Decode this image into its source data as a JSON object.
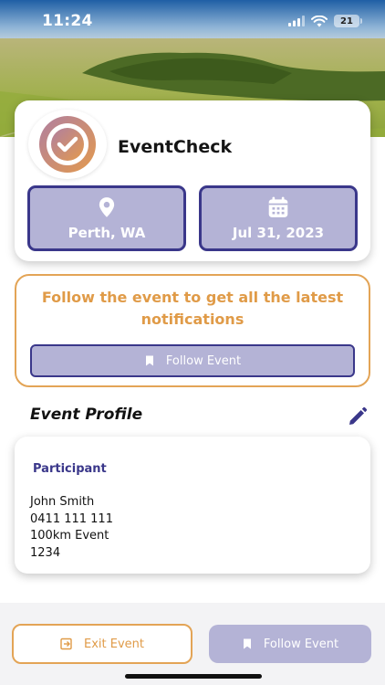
{
  "status_bar": {
    "time": "11:24",
    "battery": "21"
  },
  "event": {
    "app_name": "EventCheck",
    "location": "Perth, WA",
    "date": "Jul 31, 2023",
    "location_icon": "map-pin-icon",
    "date_icon": "calendar-icon"
  },
  "follow_prompt": {
    "message": "Follow the event to get all the latest notifications",
    "button_label": "Follow Event"
  },
  "profile": {
    "section_title": "Event Profile",
    "heading": "Participant",
    "name": "John Smith",
    "phone": "0411 111 111",
    "event_type": "100km Event",
    "number": "1234"
  },
  "bottom_bar": {
    "exit_label": "Exit Event",
    "follow_label": "Follow Event"
  },
  "colors": {
    "accent_orange": "#e3a456",
    "accent_purple": "#3a378a",
    "button_lavender": "#b4b3d6"
  }
}
